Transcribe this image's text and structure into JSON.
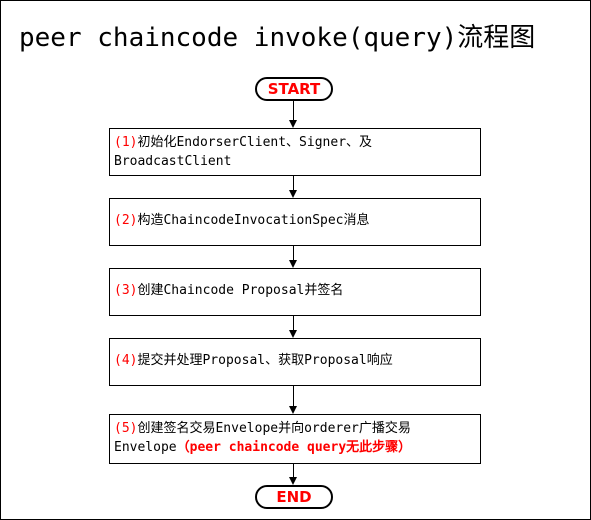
{
  "title": "peer chaincode invoke(query)流程图",
  "start_label": "START",
  "end_label": "END",
  "steps": [
    {
      "num": "(1)",
      "line1": "初始化EndorserClient、Signer、及",
      "line2": "BroadcastClient"
    },
    {
      "num": "(2)",
      "line1": "构造ChaincodeInvocationSpec消息"
    },
    {
      "num": "(3)",
      "line1": "创建Chaincode Proposal并签名"
    },
    {
      "num": "(4)",
      "line1": "提交并处理Proposal、获取Proposal响应"
    },
    {
      "num": "(5)",
      "line1": "创建签名交易Envelope并向orderer广播交易",
      "line2": "Envelope",
      "note": "（peer chaincode query无此步骤）"
    }
  ],
  "colors": {
    "accent": "#ff0000",
    "border": "#000000",
    "background": "#ffffff"
  }
}
